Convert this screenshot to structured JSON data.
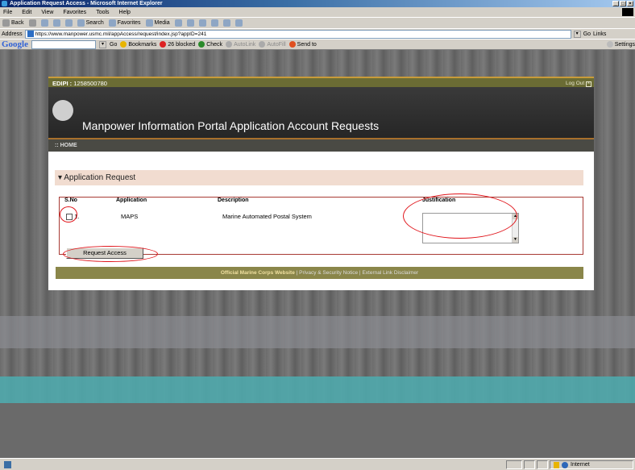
{
  "window": {
    "title": "Application Request Access - Microsoft Internet Explorer",
    "controls": [
      "_",
      "□",
      "×"
    ]
  },
  "menu": [
    "File",
    "Edit",
    "View",
    "Favorites",
    "Tools",
    "Help"
  ],
  "toolbar": {
    "back": "Back",
    "search": "Search",
    "favorites": "Favorites",
    "media": "Media"
  },
  "address": {
    "label": "Address",
    "url": "https://www.manpower.usmc.mil/appAccess/request/index.jsp?appID=241",
    "go": "Go",
    "links": "Links"
  },
  "google": {
    "logo": "Google",
    "go": "Go",
    "bookmarks": "Bookmarks",
    "blocked": "26 blocked",
    "check": "Check",
    "autolink": "AutoLink",
    "autofill": "AutoFill",
    "sendto": "Send to",
    "settings": "Settings"
  },
  "portal": {
    "edipi_label": "EDIPI :",
    "edipi_value": "1258500780",
    "logout": "Log Out",
    "banner_title": "Manpower Information Portal Application Account Requests",
    "home": ":: HOME",
    "section_title": "Application Request",
    "table": {
      "headers": [
        "S.No",
        "Application",
        "Description",
        "Justification"
      ],
      "rows": [
        {
          "sno": "1.",
          "application": "MAPS",
          "description": "Marine Automated Postal System",
          "checked": false
        }
      ]
    },
    "request_button": "Request Access",
    "footer": {
      "official": "Official Marine Corps Website",
      "privacy": "Privacy & Security Notice",
      "external": "External Link Disclaimer",
      "sep": "|"
    }
  },
  "status": {
    "zone": "Internet"
  },
  "colors": {
    "annotation": "#e0141a",
    "header_olive": "#6b6c34",
    "section_bg": "#f1dcd0"
  }
}
